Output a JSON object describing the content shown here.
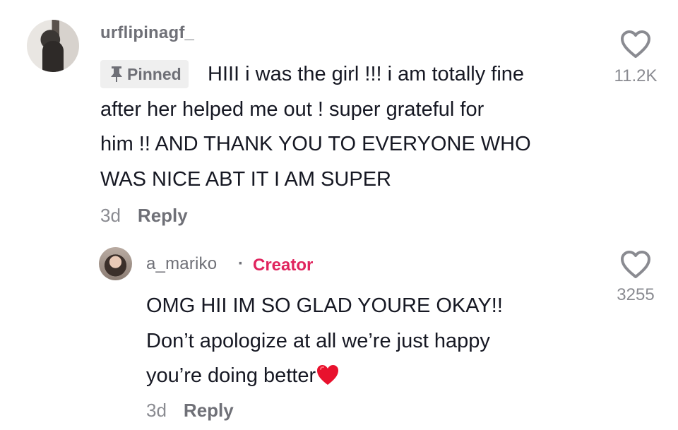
{
  "comment": {
    "username": "urflipinagf_",
    "pinned_label": "Pinned",
    "text_lines": [
      "HIII i was the girl !!! i am totally fine",
      "after her helped me out ! super grateful for",
      "him !! AND THANK YOU TO EVERYONE WHO",
      "WAS NICE ABT IT I AM SUPER"
    ],
    "age": "3d",
    "reply_label": "Reply",
    "like_count": "11.2K",
    "avatar_icon": "user-avatar",
    "like_icon": "heart-outline-icon"
  },
  "reply": {
    "username": "a_mariko",
    "separator": "·",
    "badge": "Creator",
    "badge_color": "#e0245e",
    "text_lines": [
      "OMG HII IM SO GLAD YOURE OKAY!!",
      "Don’t apologize at all we’re just happy",
      "you’re doing better"
    ],
    "emoji": "red-heart-emoji",
    "age": "3d",
    "reply_label": "Reply",
    "like_count": "3255",
    "avatar_icon": "user-avatar",
    "like_icon": "heart-outline-icon"
  }
}
